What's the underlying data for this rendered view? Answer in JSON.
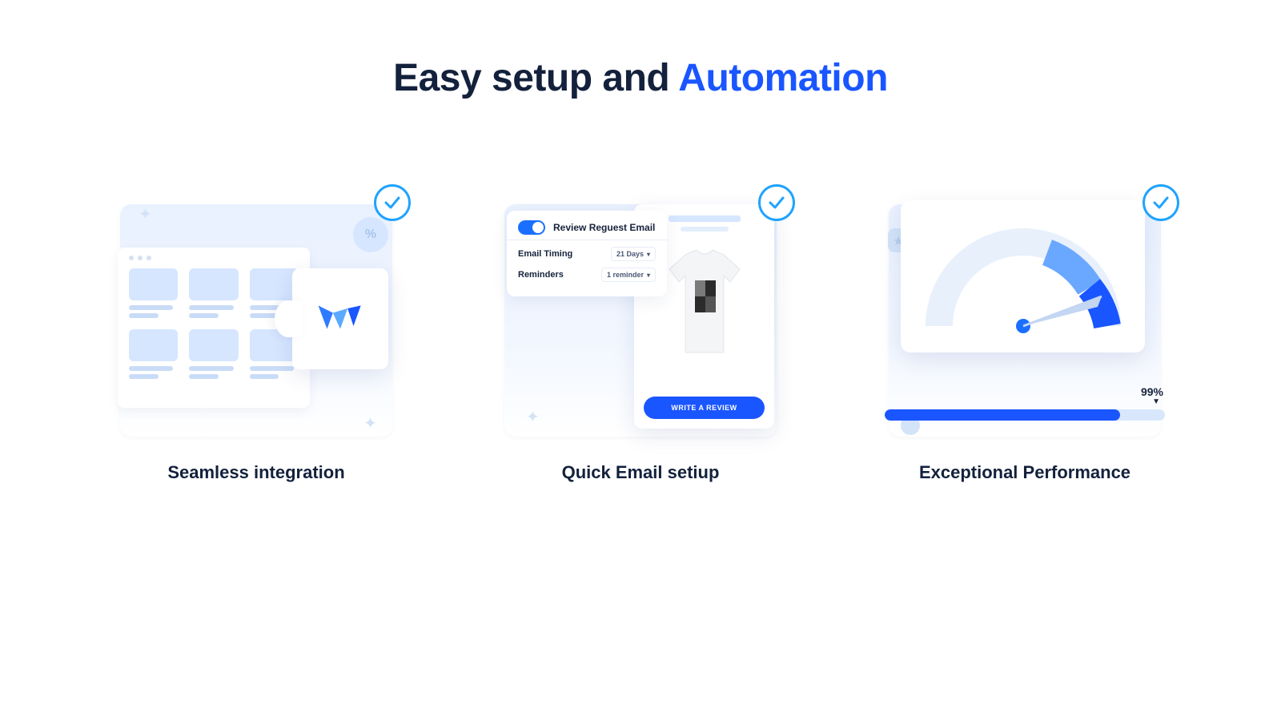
{
  "headline": {
    "prefix": "Easy setup and ",
    "accent": "Automation"
  },
  "features": {
    "integration": {
      "caption": "Seamless integration"
    },
    "email": {
      "caption": "Quick Email setiup",
      "toggle_label": "Review Reguest Email",
      "field_timing_label": "Email Timing",
      "field_timing_value": "21 Days",
      "field_reminder_label": "Reminders",
      "field_reminder_value": "1 reminder",
      "cta": "WRITE A REVIEW"
    },
    "performance": {
      "caption": "Exceptional Performance",
      "percent_label": "99%",
      "percent_value": 99
    }
  },
  "colors": {
    "accent": "#1a56ff",
    "heading": "#13213c",
    "badge_ring": "#1fa3ff",
    "pale": "#d6e6ff"
  }
}
